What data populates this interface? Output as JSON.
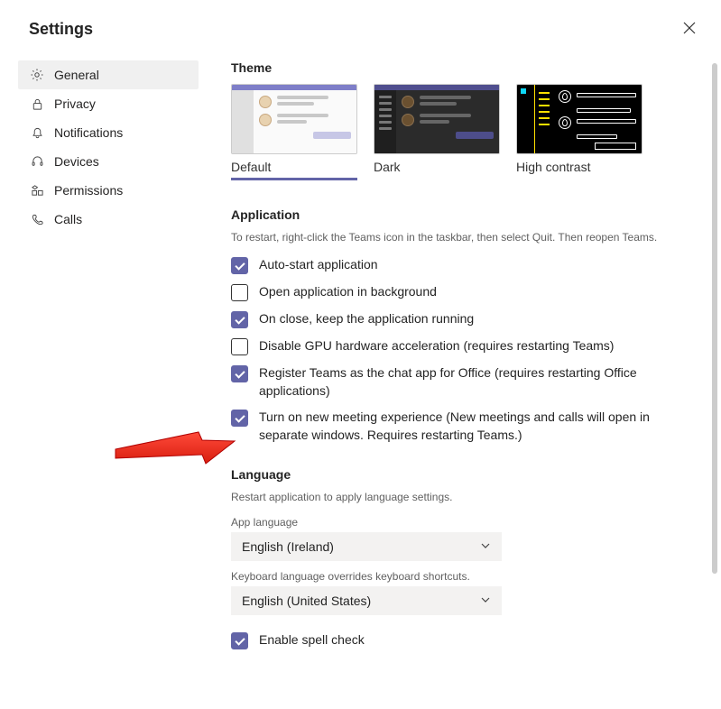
{
  "title": "Settings",
  "sidebar": {
    "items": [
      {
        "label": "General",
        "active": true
      },
      {
        "label": "Privacy",
        "active": false
      },
      {
        "label": "Notifications",
        "active": false
      },
      {
        "label": "Devices",
        "active": false
      },
      {
        "label": "Permissions",
        "active": false
      },
      {
        "label": "Calls",
        "active": false
      }
    ]
  },
  "theme": {
    "header": "Theme",
    "options": [
      {
        "label": "Default",
        "selected": true
      },
      {
        "label": "Dark",
        "selected": false
      },
      {
        "label": "High contrast",
        "selected": false
      }
    ]
  },
  "application": {
    "header": "Application",
    "note": "To restart, right-click the Teams icon in the taskbar, then select Quit. Then reopen Teams.",
    "items": [
      {
        "checked": true,
        "label": "Auto-start application"
      },
      {
        "checked": false,
        "label": "Open application in background"
      },
      {
        "checked": true,
        "label": "On close, keep the application running"
      },
      {
        "checked": false,
        "label": "Disable GPU hardware acceleration (requires restarting Teams)"
      },
      {
        "checked": true,
        "label": "Register Teams as the chat app for Office (requires restarting Office applications)"
      },
      {
        "checked": true,
        "label": "Turn on new meeting experience (New meetings and calls will open in separate windows. Requires restarting Teams.)"
      }
    ]
  },
  "language": {
    "header": "Language",
    "note": "Restart application to apply language settings.",
    "app_lang_label": "App language",
    "app_lang_value": "English (Ireland)",
    "keyboard_label": "Keyboard language overrides keyboard shortcuts.",
    "keyboard_value": "English (United States)",
    "spellcheck": {
      "checked": true,
      "label": "Enable spell check"
    }
  },
  "colors": {
    "accent": "#6264a7"
  }
}
